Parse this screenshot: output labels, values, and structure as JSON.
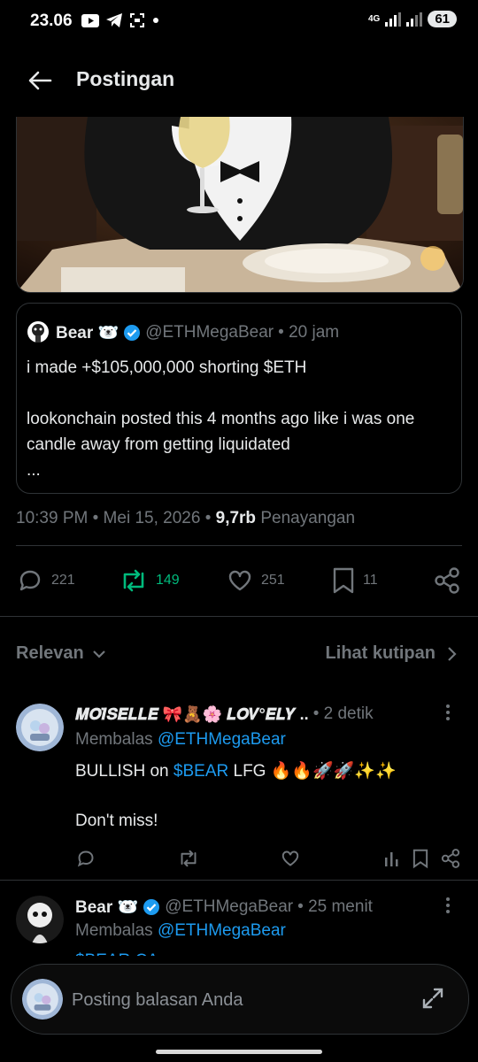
{
  "status_bar": {
    "time": "23.06",
    "network": "4G",
    "battery": "61"
  },
  "header": {
    "title": "Postingan"
  },
  "quoted_post": {
    "display_name": "Bear 🐻‍❄️",
    "handle": "@ETHMegaBear",
    "time": "• 20 jam",
    "text": "i made +$105,000,000 shorting $ETH\n\nlookonchain posted this 4 months ago like i was one candle away from getting liquidated\n..."
  },
  "post_meta": {
    "time": "10:39 PM",
    "sep1": "•",
    "date": "Mei 15, 2026",
    "sep2": "•",
    "views_count": "9,7rb",
    "views_label": "Penayangan"
  },
  "actions": {
    "replies": "221",
    "reposts": "149",
    "likes": "251",
    "bookmarks": "11"
  },
  "sort": {
    "relevan_label": "Relevan",
    "quotes_label": "Lihat kutipan"
  },
  "replies": [
    {
      "display_name": "𝑴𝑶𝑰̈𝑺𝑬𝑳𝑳𝑬 🎀🧸🌸 𝑳𝑶𝑽°𝑬𝑳𝒀 ..",
      "time": "• 2 detik",
      "replying_label": "Membalas",
      "replying_handle": "@ETHMegaBear",
      "text_prefix": "BULLISH on",
      "cashtag": "$BEAR",
      "text_suffix": "LFG 🔥🔥🚀🚀✨✨",
      "text_line2": "Don't miss!"
    },
    {
      "display_name": "Bear 🐻‍❄️",
      "handle": "@ETHMegaBear",
      "time": "• 25 menit",
      "replying_label": "Membalas",
      "replying_handle": "@ETHMegaBear",
      "text_partial": "$BEAR CA:"
    }
  ],
  "composer": {
    "placeholder": "Posting balasan Anda"
  },
  "colors": {
    "accent_blue": "#1d9bf0",
    "repost_green": "#00ba7c",
    "muted": "#71767b"
  },
  "icons": [
    "back-arrow-icon",
    "reply-icon",
    "repost-icon",
    "like-icon",
    "bookmark-icon",
    "share-icon",
    "chevron-down-icon",
    "chevron-right-icon",
    "more-icon",
    "analytics-icon",
    "verified-badge-icon",
    "expand-icon"
  ]
}
